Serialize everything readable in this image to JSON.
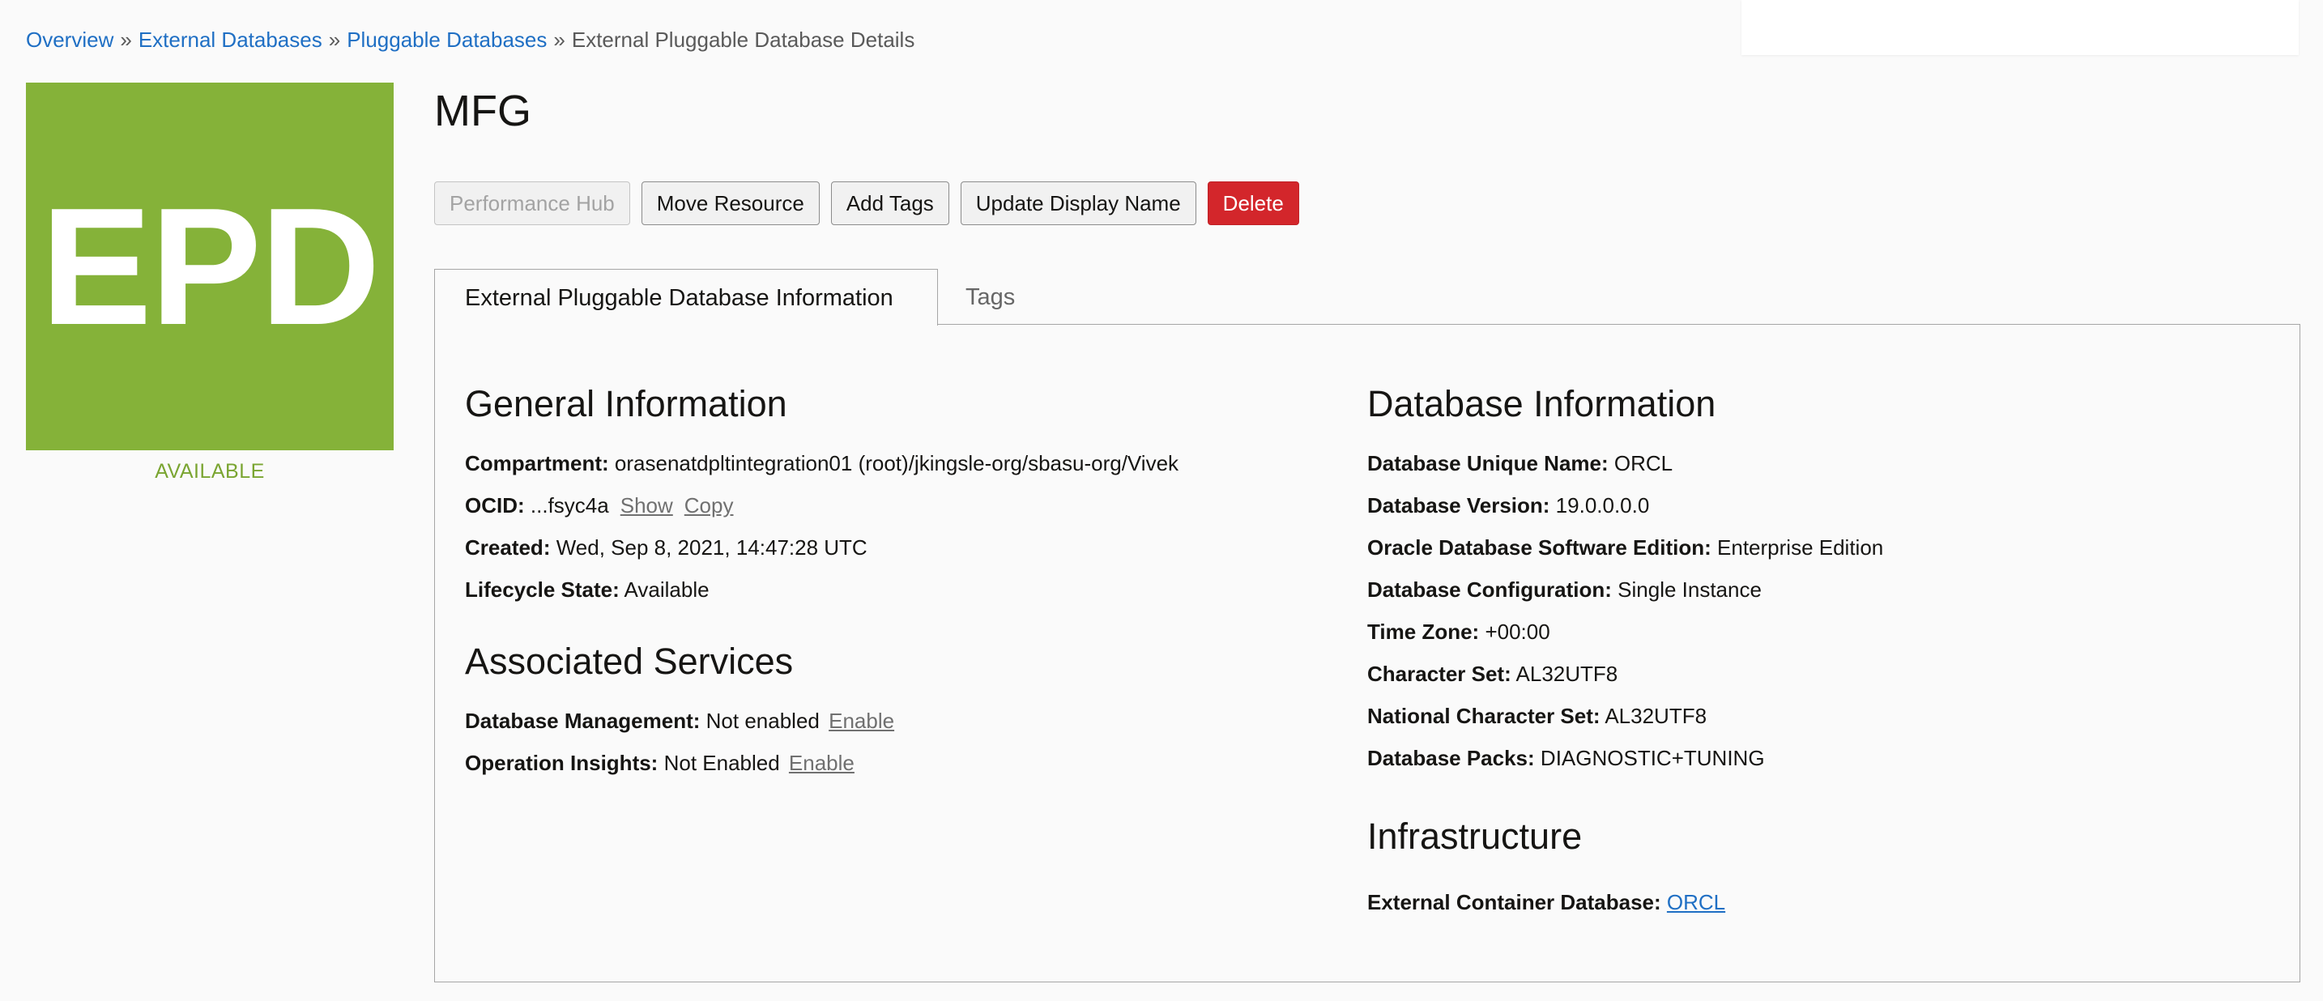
{
  "breadcrumb": {
    "items": [
      {
        "label": "Overview"
      },
      {
        "label": "External Databases"
      },
      {
        "label": "Pluggable Databases"
      }
    ],
    "separator": "»",
    "current": "External Pluggable Database Details"
  },
  "badge": {
    "text": "EPD",
    "status": "AVAILABLE",
    "color": "#85b239"
  },
  "title": "MFG",
  "actions": {
    "performance_hub": "Performance Hub",
    "move_resource": "Move Resource",
    "add_tags": "Add Tags",
    "update_display_name": "Update Display Name",
    "delete": "Delete"
  },
  "tabs": {
    "info": "External Pluggable Database Information",
    "tags": "Tags"
  },
  "general": {
    "title": "General Information",
    "compartment_label": "Compartment:",
    "compartment_value": "orasenatdpltintegration01 (root)/jkingsle-org/sbasu-org/Vivek",
    "ocid_label": "OCID:",
    "ocid_value": "...fsyc4a",
    "ocid_show": "Show",
    "ocid_copy": "Copy",
    "created_label": "Created:",
    "created_value": "Wed, Sep 8, 2021, 14:47:28 UTC",
    "lifecycle_label": "Lifecycle State:",
    "lifecycle_value": "Available"
  },
  "services": {
    "title": "Associated Services",
    "dbm_label": "Database Management:",
    "dbm_value": "Not enabled",
    "dbm_action": "Enable",
    "opsi_label": "Operation Insights:",
    "opsi_value": "Not Enabled",
    "opsi_action": "Enable"
  },
  "database": {
    "title": "Database Information",
    "unique_name_label": "Database Unique Name:",
    "unique_name_value": "ORCL",
    "version_label": "Database Version:",
    "version_value": "19.0.0.0.0",
    "edition_label": "Oracle Database Software Edition:",
    "edition_value": "Enterprise Edition",
    "config_label": "Database Configuration:",
    "config_value": "Single Instance",
    "tz_label": "Time Zone:",
    "tz_value": "+00:00",
    "charset_label": "Character Set:",
    "charset_value": "AL32UTF8",
    "ncharset_label": "National Character Set:",
    "ncharset_value": "AL32UTF8",
    "packs_label": "Database Packs:",
    "packs_value": "DIAGNOSTIC+TUNING"
  },
  "infrastructure": {
    "title": "Infrastructure",
    "container_label": "External Container Database:",
    "container_value": "ORCL"
  },
  "colors": {
    "link": "#1f6fc4",
    "danger": "#d3262b",
    "available": "#7aa531"
  }
}
